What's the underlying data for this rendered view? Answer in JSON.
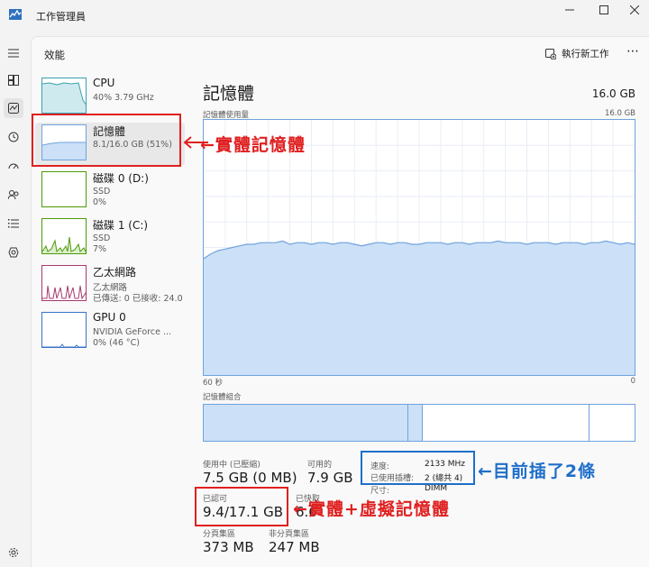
{
  "window": {
    "title": "工作管理員"
  },
  "header": {
    "page_title": "效能",
    "run_new_task": "執行新工作"
  },
  "sidebar": {
    "items": [
      {
        "title": "CPU",
        "sub1": "40% 3.79 GHz",
        "sub2": "",
        "sub3": ""
      },
      {
        "title": "記憶體",
        "sub1": "8.1/16.0 GB (51%)",
        "sub2": "",
        "sub3": ""
      },
      {
        "title": "磁碟 0 (D:)",
        "sub1": "SSD",
        "sub2": "0%",
        "sub3": ""
      },
      {
        "title": "磁碟 1 (C:)",
        "sub1": "SSD",
        "sub2": "7%",
        "sub3": ""
      },
      {
        "title": "乙太網路",
        "sub1": "乙太網路",
        "sub2": "已傳送: 0 已接收: 24.0 I",
        "sub3": ""
      },
      {
        "title": "GPU 0",
        "sub1": "NVIDIA GeForce ...",
        "sub2": "0% (46 °C)",
        "sub3": ""
      }
    ]
  },
  "memory": {
    "title": "記憶體",
    "total": "16.0 GB",
    "usage_label": "記憶體使用量",
    "usage_max": "16.0 GB",
    "axis_left": "60 秒",
    "axis_right": "0",
    "composition_label": "記憶體組合",
    "in_use_label": "使用中 (已壓縮)",
    "in_use_value": "7.5 GB (0 MB)",
    "available_label": "可用的",
    "available_value": "7.9 GB",
    "committed_label": "已認可",
    "committed_value": "9.4/17.1 GB",
    "cached_label": "已快取",
    "cached_value": "6.6",
    "paged_label": "分頁集區",
    "paged_value": "373 MB",
    "nonpaged_label": "非分頁集區",
    "nonpaged_value": "247 MB",
    "speed_label": "速度:",
    "speed_value": "2133 MHz",
    "slots_label": "已使用插槽:",
    "slots_value": "2 (總共 4)",
    "form_label": "尺寸:",
    "form_value": "DIMM"
  },
  "annotations": {
    "physical": "←實體記憶體",
    "slots": "←目前插了2條",
    "virtual": "←實體+虛擬記憶體"
  },
  "chart_data": {
    "type": "area",
    "title": "記憶體使用量",
    "ylim": [
      0,
      16.0
    ],
    "y_unit": "GB",
    "x_range_seconds": [
      60,
      0
    ],
    "values": [
      7.3,
      7.6,
      7.8,
      7.9,
      8.0,
      8.1,
      8.2,
      8.2,
      8.3,
      8.3,
      8.3,
      8.4,
      8.2,
      8.3,
      8.3,
      8.2,
      8.3,
      8.3,
      8.2,
      8.3,
      8.3,
      8.2,
      8.1,
      8.2,
      8.3,
      8.3,
      8.2,
      8.3,
      8.3,
      8.2,
      8.2,
      8.3,
      8.3,
      8.3,
      8.2,
      8.3,
      8.3,
      8.2,
      8.3,
      8.3,
      8.3,
      8.4,
      8.3,
      8.3,
      8.3,
      8.2,
      8.3,
      8.3,
      8.3,
      8.2,
      8.3,
      8.3,
      8.3,
      8.2,
      8.3,
      8.3,
      8.4,
      8.3,
      8.2,
      8.3,
      8.2
    ]
  },
  "colors": {
    "memory_accent": "#6ea3dd",
    "memory_fill": "#cce0f7",
    "cpu": "#3aa0b0",
    "disk1": "#4e9a06",
    "net": "#a53a6e",
    "annotation_red": "#e02020",
    "annotation_blue": "#1f6fc9"
  }
}
